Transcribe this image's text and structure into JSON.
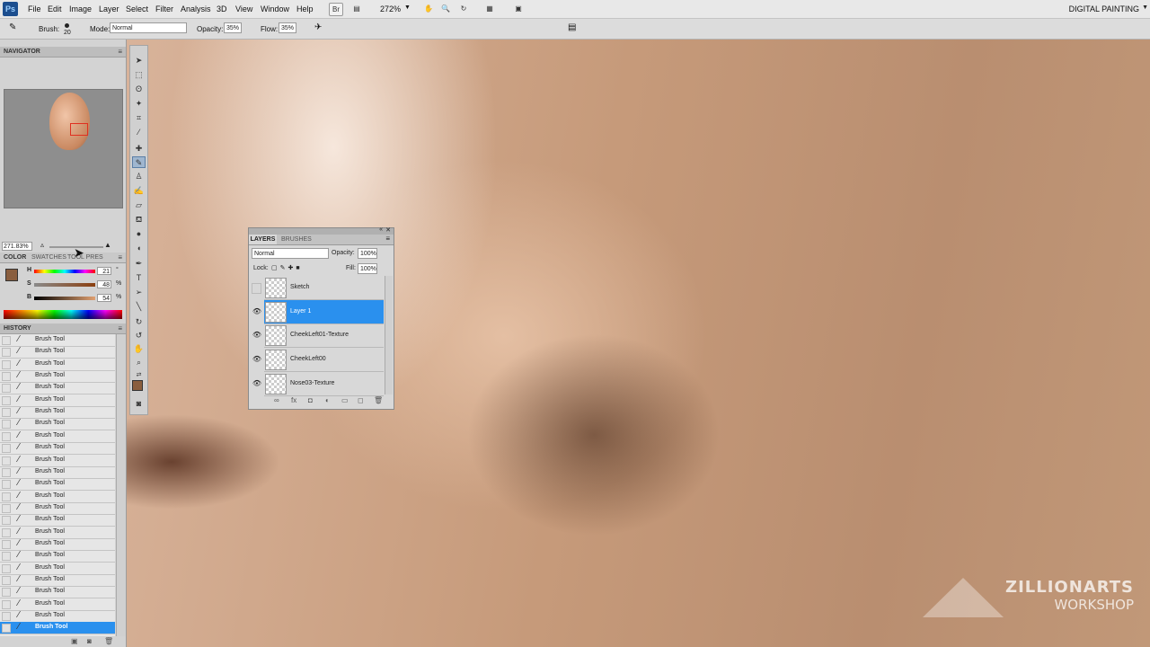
{
  "app": {
    "logo": "Ps",
    "workspace": "DIGITAL PAINTING"
  },
  "menu": [
    "File",
    "Edit",
    "Image",
    "Layer",
    "Select",
    "Filter",
    "Analysis",
    "3D",
    "View",
    "Window",
    "Help"
  ],
  "menubar_icons": [
    "Br",
    "▤",
    "✋",
    "🔍",
    "↻",
    "▦",
    "▣"
  ],
  "zoom_menu": "272%",
  "options": {
    "brush_label": "Brush:",
    "brush_size": "20",
    "mode_label": "Mode:",
    "mode_value": "Normal",
    "opacity_label": "Opacity:",
    "opacity_value": "35%",
    "flow_label": "Flow:",
    "flow_value": "35%"
  },
  "navigator": {
    "title": "NAVIGATOR",
    "zoom": "271.83%"
  },
  "color_panel": {
    "tabs": [
      "COLOR",
      "SWATCHES",
      "TOOL PRESETS"
    ],
    "h": {
      "label": "H",
      "value": "21",
      "unit": "°"
    },
    "s": {
      "label": "S",
      "value": "48",
      "unit": "%"
    },
    "b": {
      "label": "B",
      "value": "54",
      "unit": "%"
    },
    "foreground": "#8a5e3e"
  },
  "history": {
    "title": "HISTORY",
    "items": [
      "Brush Tool",
      "Brush Tool",
      "Brush Tool",
      "Brush Tool",
      "Brush Tool",
      "Brush Tool",
      "Brush Tool",
      "Brush Tool",
      "Brush Tool",
      "Brush Tool",
      "Brush Tool",
      "Brush Tool",
      "Brush Tool",
      "Brush Tool",
      "Brush Tool",
      "Brush Tool",
      "Brush Tool",
      "Brush Tool",
      "Brush Tool",
      "Brush Tool",
      "Brush Tool",
      "Brush Tool",
      "Brush Tool",
      "Brush Tool",
      "Brush Tool"
    ]
  },
  "layers_panel": {
    "tabs": [
      "LAYERS",
      "BRUSHES"
    ],
    "blend_mode": "Normal",
    "opacity_label": "Opacity:",
    "opacity_value": "100%",
    "lock_label": "Lock:",
    "fill_label": "Fill:",
    "fill_value": "100%",
    "layers": [
      {
        "name": "Sketch",
        "visible": false,
        "selected": false
      },
      {
        "name": "Layer 1",
        "visible": true,
        "selected": true
      },
      {
        "name": "CheekLeft01-Texture",
        "visible": true,
        "selected": false
      },
      {
        "name": "CheekLeft00",
        "visible": true,
        "selected": false
      },
      {
        "name": "Nose03-Texture",
        "visible": true,
        "selected": false
      }
    ]
  },
  "watermark": {
    "line1": "ZILLIONARTS",
    "line2": "WORKSHOP"
  },
  "accent_color": "#2a90ee"
}
